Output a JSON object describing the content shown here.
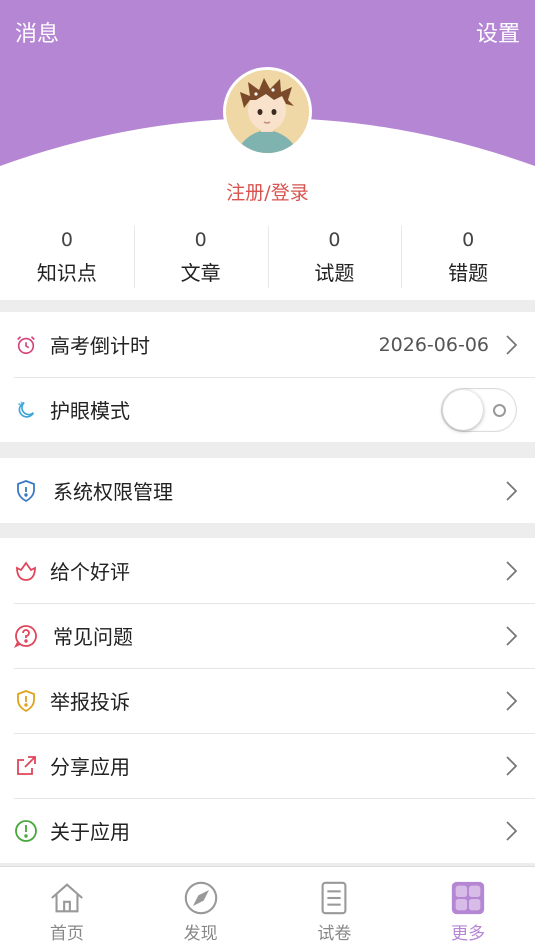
{
  "header": {
    "left_link": "消息",
    "right_link": "设置",
    "login_text": "注册/登录"
  },
  "colors": {
    "accent": "#b586d4",
    "login_red": "#d9534f"
  },
  "stats": [
    {
      "value": "0",
      "label": "知识点"
    },
    {
      "value": "0",
      "label": "文章"
    },
    {
      "value": "0",
      "label": "试题"
    },
    {
      "value": "0",
      "label": "错题"
    }
  ],
  "settings": {
    "countdown": {
      "label": "高考倒计时",
      "value": "2026-06-06",
      "icon": "alarm-clock-icon"
    },
    "eye_mode": {
      "label": "护眼模式",
      "icon": "moon-icon",
      "enabled": false
    },
    "permissions": {
      "label": "系统权限管理",
      "icon": "shield-icon"
    }
  },
  "menu": [
    {
      "label": "给个好评",
      "icon": "flower-icon"
    },
    {
      "label": "常见问题",
      "icon": "question-icon"
    },
    {
      "label": "举报投诉",
      "icon": "warning-shield-icon"
    },
    {
      "label": "分享应用",
      "icon": "share-icon"
    },
    {
      "label": "关于应用",
      "icon": "info-icon"
    }
  ],
  "tabs": [
    {
      "label": "首页",
      "icon": "home-icon",
      "active": false
    },
    {
      "label": "发现",
      "icon": "compass-icon",
      "active": false
    },
    {
      "label": "试卷",
      "icon": "paper-icon",
      "active": false
    },
    {
      "label": "更多",
      "icon": "grid-icon",
      "active": true
    }
  ]
}
